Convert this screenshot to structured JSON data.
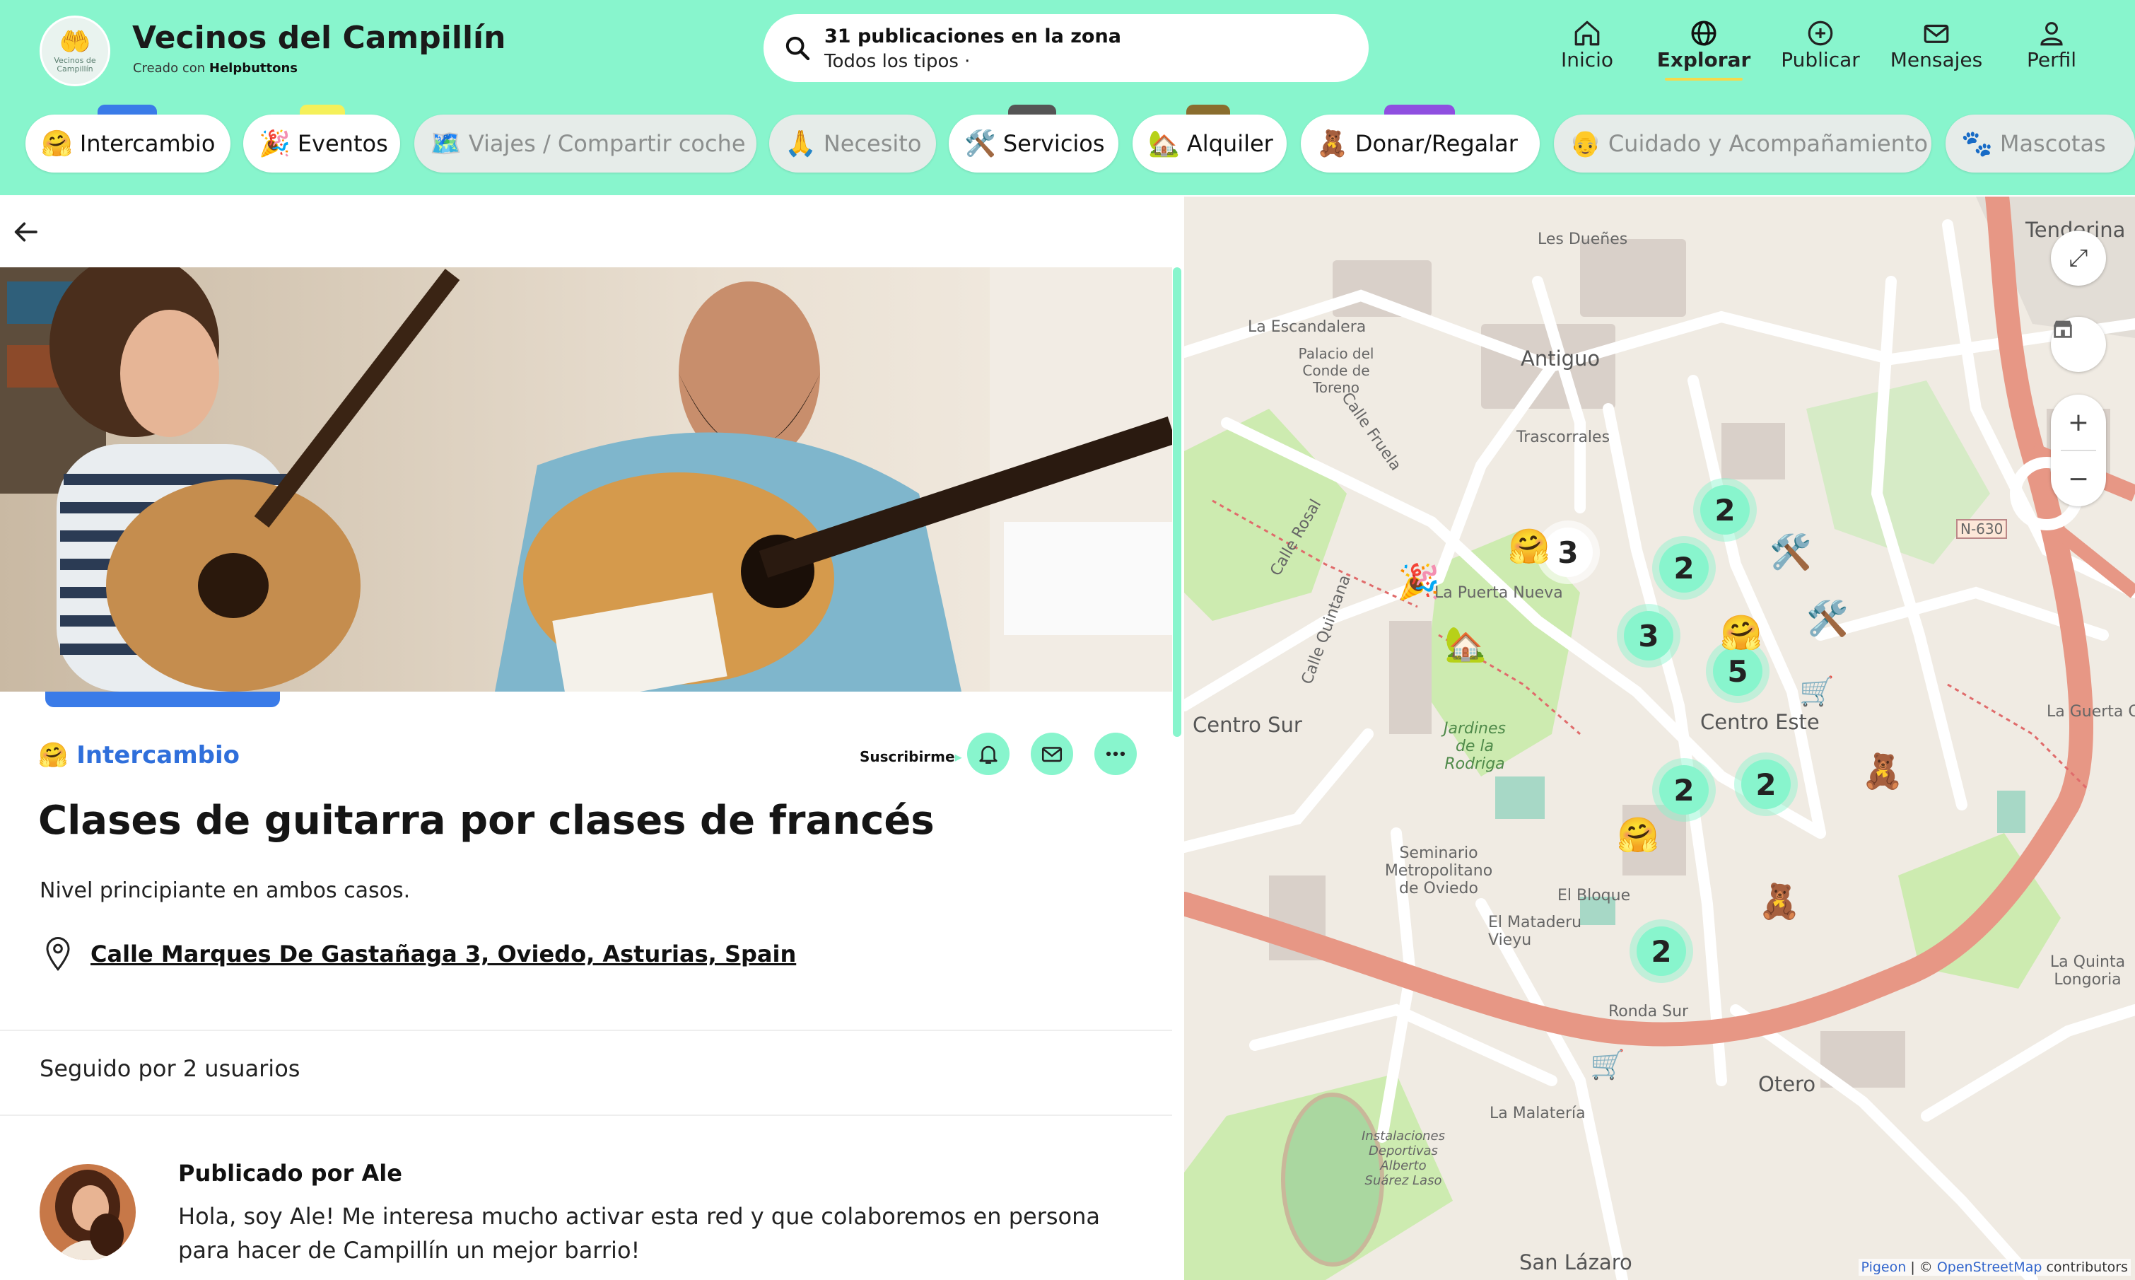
{
  "header": {
    "logo_text": "Vecinos de Campillín",
    "title": "Vecinos del Campillín",
    "created_with": "Creado con",
    "created_with_brand": "Helpbuttons",
    "search_line1": "31 publicaciones en la zona",
    "search_line2": "Todos los tipos ·",
    "nav": [
      {
        "label": "Inicio",
        "icon": "home-icon"
      },
      {
        "label": "Explorar",
        "icon": "globe-icon"
      },
      {
        "label": "Publicar",
        "icon": "plus-circle-icon"
      },
      {
        "label": "Mensajes",
        "icon": "mail-icon"
      },
      {
        "label": "Perfil",
        "icon": "user-icon"
      }
    ]
  },
  "categories": [
    {
      "emoji": "🤗",
      "label": "Intercambio",
      "tab_color": "#3a7be8"
    },
    {
      "emoji": "🎉",
      "label": "Eventos",
      "tab_color": "#f5f05a"
    },
    {
      "emoji": "🗺️",
      "label": "Viajes / Compartir coche",
      "tab_color": ""
    },
    {
      "emoji": "🙏",
      "label": "Necesito",
      "tab_color": ""
    },
    {
      "emoji": "🛠️",
      "label": "Servicios",
      "tab_color": "#555555"
    },
    {
      "emoji": "🏡",
      "label": "Alquiler",
      "tab_color": "#8a6d2e"
    },
    {
      "emoji": "🧸",
      "label": "Donar/Regalar",
      "tab_color": "#8f4fe0"
    },
    {
      "emoji": "👴",
      "label": "Cuidado y Acompañamiento",
      "tab_color": ""
    },
    {
      "emoji": "🐾",
      "label": "Mascotas",
      "tab_color": ""
    }
  ],
  "post": {
    "category_emoji": "🤗",
    "category": "Intercambio",
    "subscribe_label": "Suscribirme",
    "title": "Clases de guitarra por clases de francés",
    "description": "Nivel principiante en ambos casos.",
    "location": "Calle Marques De Gastañaga 3, Oviedo, Asturias, Spain",
    "followers": "Seguido por 2 usuarios",
    "author_title": "Publicado por Ale",
    "author_bio": "Hola, soy Ale! Me interesa mucho activar esta red y que colaboremos en persona para hacer de Campillín un mejor barrio!"
  },
  "map": {
    "labels": [
      {
        "text": "Antiguo",
        "big": true
      },
      {
        "text": "Trascorrales",
        "big": false
      },
      {
        "text": "Centro Sur",
        "big": true
      },
      {
        "text": "Centro Este",
        "big": true
      },
      {
        "text": "Otero",
        "big": true
      },
      {
        "text": "San Lázaro",
        "big": true
      },
      {
        "text": "La Escandalera",
        "big": false
      },
      {
        "text": "Les Dueñes",
        "big": false
      },
      {
        "text": "El Bloque",
        "big": false
      },
      {
        "text": "El Mataderu Vieyu",
        "big": false
      },
      {
        "text": "La Malatería",
        "big": false
      },
      {
        "text": "La Puerta Nueva",
        "big": false
      },
      {
        "text": "Tenderina",
        "big": true
      },
      {
        "text": "Seminario Metropolitano de Oviedo",
        "big": false
      },
      {
        "text": "Palacio del Conde de Toreno",
        "big": false
      },
      {
        "text": "Jardines de la Rodriga",
        "big": false
      },
      {
        "text": "La Guerta Otero",
        "big": false
      },
      {
        "text": "La Quinta Longoria",
        "big": false
      },
      {
        "text": "Ronda Sur",
        "big": false
      },
      {
        "text": "Calle Rosal",
        "big": false
      },
      {
        "text": "Calle Quintana",
        "big": false
      },
      {
        "text": "Calle Fruela",
        "big": false
      },
      {
        "text": "N-630",
        "big": false
      },
      {
        "text": "Instalaciones Deportivas Alberto Suárez Laso",
        "big": false
      }
    ],
    "clusters": [
      "2",
      "2",
      "3",
      "5",
      "2",
      "2",
      "2",
      "3"
    ],
    "markers": [
      {
        "emoji": "🤗"
      },
      {
        "emoji": "🤗"
      },
      {
        "emoji": "🛠️"
      },
      {
        "emoji": "🛠️"
      },
      {
        "emoji": "🧸"
      },
      {
        "emoji": "🧸"
      },
      {
        "emoji": "🏡"
      },
      {
        "emoji": "🎉"
      },
      {
        "emoji": "🛒"
      },
      {
        "emoji": "🛒"
      }
    ],
    "controls": {
      "fullscreen": "⤢",
      "zoom_in": "+",
      "zoom_out": "−"
    },
    "attribution": {
      "pigeon": "Pigeon",
      "sep": " | © ",
      "osm": "OpenStreetMap",
      "contrib": " contributors"
    }
  },
  "colors": {
    "accent": "#88f5cd",
    "link": "#2f6fdb",
    "road_main": "#e79785",
    "park": "#cdebb0"
  }
}
